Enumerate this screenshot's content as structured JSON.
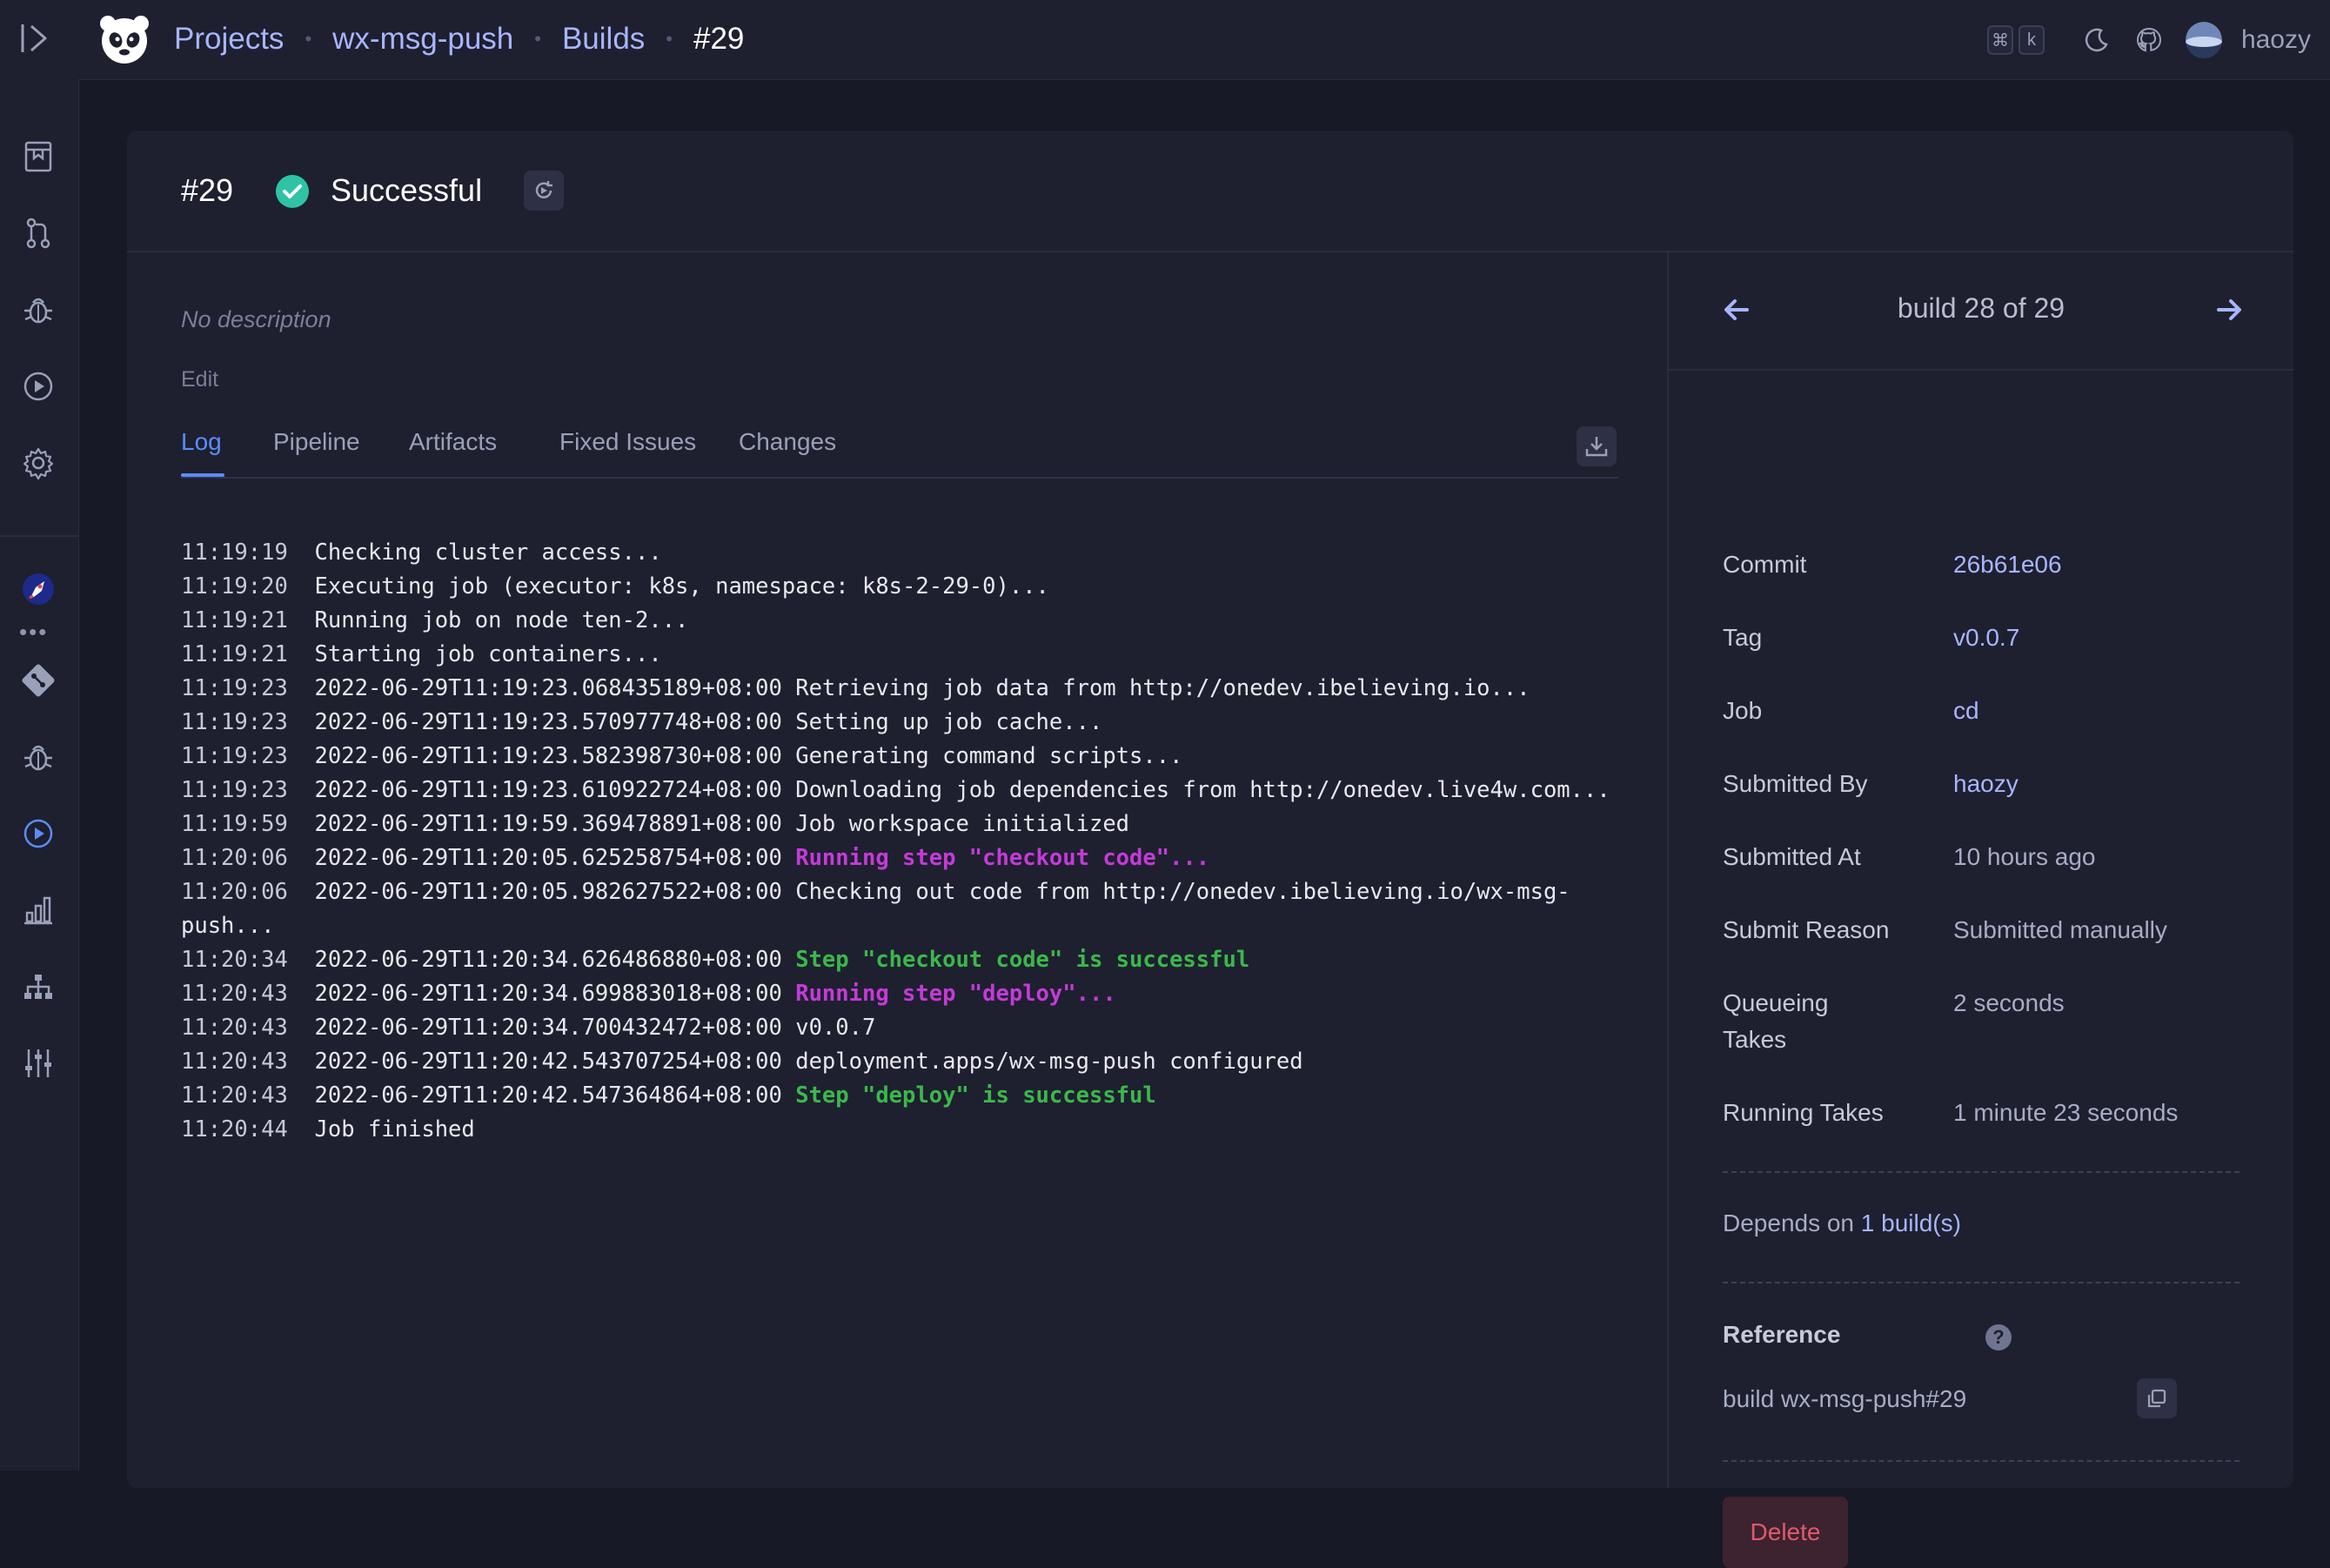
{
  "breadcrumb": {
    "projects": "Projects",
    "project": "wx-msg-push",
    "builds": "Builds",
    "current": "#29"
  },
  "shortcut": {
    "cmd": "⌘",
    "key": "k"
  },
  "user": {
    "name": "haozy"
  },
  "build": {
    "number": "#29",
    "status": "Successful",
    "description": "No description",
    "edit_label": "Edit"
  },
  "tabs": [
    {
      "label": "Log"
    },
    {
      "label": "Pipeline"
    },
    {
      "label": "Artifacts"
    },
    {
      "label": "Fixed Issues"
    },
    {
      "label": "Changes"
    }
  ],
  "log": [
    {
      "ts": "11:19:19",
      "text": "Checking cluster access...",
      "kind": "normal"
    },
    {
      "ts": "11:19:20",
      "text": "Executing job (executor: k8s, namespace: k8s-2-29-0)...",
      "kind": "normal"
    },
    {
      "ts": "11:19:21",
      "text": "Running job on node ten-2...",
      "kind": "normal"
    },
    {
      "ts": "11:19:21",
      "text": "Starting job containers...",
      "kind": "normal"
    },
    {
      "ts": "11:19:23",
      "text": "2022-06-29T11:19:23.068435189+08:00 Retrieving job data from http://onedev.ibelieving.io...",
      "kind": "normal"
    },
    {
      "ts": "11:19:23",
      "text": "2022-06-29T11:19:23.570977748+08:00 Setting up job cache...",
      "kind": "normal"
    },
    {
      "ts": "11:19:23",
      "text": "2022-06-29T11:19:23.582398730+08:00 Generating command scripts...",
      "kind": "normal"
    },
    {
      "ts": "11:19:23",
      "text": "2022-06-29T11:19:23.610922724+08:00 Downloading job dependencies from http://onedev.live4w.com...",
      "kind": "normal"
    },
    {
      "ts": "11:19:59",
      "text": "2022-06-29T11:19:59.369478891+08:00 Job workspace initialized",
      "kind": "normal"
    },
    {
      "ts": "11:20:06",
      "prefix": "2022-06-29T11:20:05.625258754+08:00 ",
      "text": "Running step \"checkout code\"...",
      "kind": "step"
    },
    {
      "ts": "11:20:06",
      "text": "2022-06-29T11:20:05.982627522+08:00 Checking out code from http://onedev.ibelieving.io/wx-msg-push...",
      "kind": "normal"
    },
    {
      "ts": "11:20:34",
      "prefix": "2022-06-29T11:20:34.626486880+08:00 ",
      "text": "Step \"checkout code\" is successful",
      "kind": "ok"
    },
    {
      "ts": "11:20:43",
      "prefix": "2022-06-29T11:20:34.699883018+08:00 ",
      "text": "Running step \"deploy\"...",
      "kind": "step"
    },
    {
      "ts": "11:20:43",
      "text": "2022-06-29T11:20:34.700432472+08:00 v0.0.7",
      "kind": "normal"
    },
    {
      "ts": "11:20:43",
      "text": "2022-06-29T11:20:42.543707254+08:00 deployment.apps/wx-msg-push configured",
      "kind": "normal"
    },
    {
      "ts": "11:20:43",
      "prefix": "2022-06-29T11:20:42.547364864+08:00 ",
      "text": "Step \"deploy\" is successful",
      "kind": "ok"
    },
    {
      "ts": "11:20:44",
      "text": "Job finished",
      "kind": "normal"
    }
  ],
  "nav": {
    "label": "build 28 of 29"
  },
  "info": {
    "commit": {
      "k": "Commit",
      "v": "26b61e06"
    },
    "tag": {
      "k": "Tag",
      "v": "v0.0.7"
    },
    "job": {
      "k": "Job",
      "v": "cd"
    },
    "submitted_by": {
      "k": "Submitted By",
      "v": "haozy"
    },
    "submitted_at": {
      "k": "Submitted At",
      "v": "10 hours ago"
    },
    "submit_reason": {
      "k": "Submit Reason",
      "v": "Submitted manually"
    },
    "queueing": {
      "k": "Queueing Takes",
      "v": "2 seconds"
    },
    "running": {
      "k": "Running Takes",
      "v": "1 minute 23 seconds"
    }
  },
  "depends": {
    "prefix": "Depends on ",
    "link": "1 build(s)"
  },
  "reference": {
    "title": "Reference",
    "help": "?",
    "value": "build wx-msg-push#29"
  },
  "delete_label": "Delete",
  "colors": {
    "accent": "#5b8cff",
    "link": "#a8b5ff",
    "success": "#3bb84a",
    "step": "#c53ad8",
    "danger": "#e05a6a",
    "status_ok": "#2fc3a5"
  }
}
